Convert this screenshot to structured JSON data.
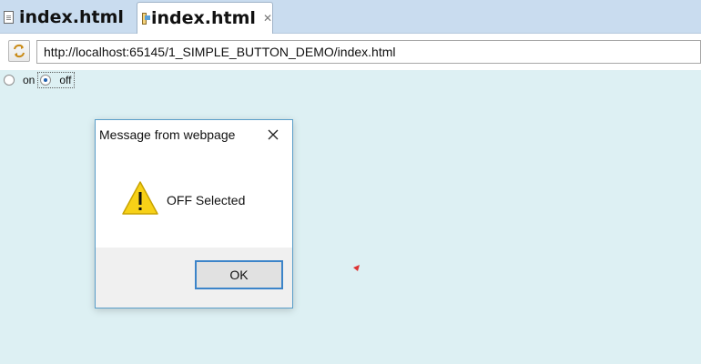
{
  "tabs": [
    {
      "label": "index.html",
      "active": false
    },
    {
      "label": "index.html",
      "active": true,
      "close_glyph": "✕"
    }
  ],
  "toolbar": {
    "reload_icon": "reload-icon",
    "url": "http://localhost:65145/1_SIMPLE_BUTTON_DEMO/index.html"
  },
  "page": {
    "radio_on_label": "on",
    "radio_off_label": "off",
    "selected": "off"
  },
  "dialog": {
    "title": "Message from webpage",
    "message": "OFF Selected",
    "ok_label": "OK",
    "icon": "warning-icon"
  },
  "colors": {
    "tabstrip": "#c9dcef",
    "page_background": "#ddf0f3",
    "dialog_border": "#5a9ec9",
    "ok_border": "#3c84c9",
    "warning_fill": "#f7d117"
  }
}
